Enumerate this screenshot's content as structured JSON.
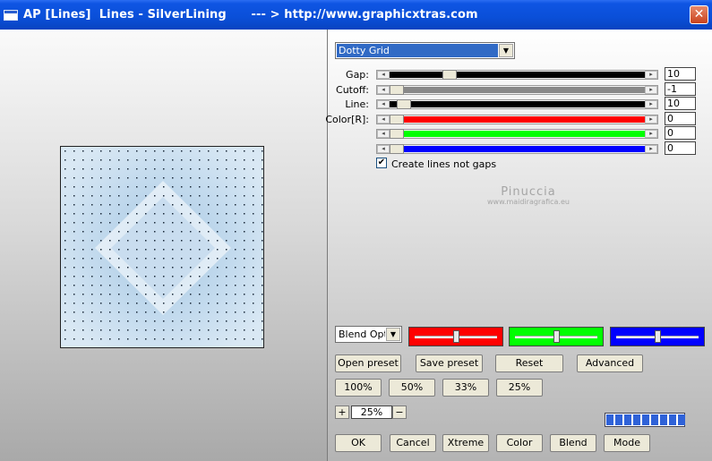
{
  "window": {
    "title": "AP [Lines]  Lines - SilverLining      --- > http://www.graphicxtras.com",
    "close": "✕"
  },
  "effect_dropdown": {
    "value": "Dotty Grid"
  },
  "sliders": [
    {
      "id": "gap",
      "label": "Gap:",
      "value": "10",
      "fill": "#000000",
      "thumb_fraction": 0.22
    },
    {
      "id": "cutoff",
      "label": "Cutoff:",
      "value": "-1",
      "fill": "#888888",
      "thumb_fraction": 0.0
    },
    {
      "id": "line",
      "label": "Line:",
      "value": "10",
      "fill": "#000000",
      "thumb_fraction": 0.03
    },
    {
      "id": "color-r",
      "label": "Color[R]:",
      "value": "0",
      "fill": "#ff0000",
      "thumb_fraction": 0.0
    },
    {
      "id": "color-g",
      "label": "",
      "value": "0",
      "fill": "#00ff00",
      "thumb_fraction": 0.0
    },
    {
      "id": "color-b",
      "label": "",
      "value": "0",
      "fill": "#0000ff",
      "thumb_fraction": 0.0
    }
  ],
  "checkbox": {
    "label": "Create lines not gaps",
    "checked": true,
    "mark": "✔"
  },
  "watermark": {
    "line1": "Pinuccia",
    "line2": "www.maidiragrafica.eu"
  },
  "blend_dropdown": {
    "value": "Blend Optic"
  },
  "color_sliders": [
    {
      "name": "red",
      "color": "#ff0000",
      "level": 0.5
    },
    {
      "name": "green",
      "color": "#00ff00",
      "level": 0.5
    },
    {
      "name": "blue",
      "color": "#0000ff",
      "level": 0.5
    }
  ],
  "preset_buttons": {
    "open": "Open preset",
    "save": "Save preset",
    "reset": "Reset",
    "advanced": "Advanced"
  },
  "zoom_buttons": [
    "100%",
    "50%",
    "33%",
    "25%"
  ],
  "zoom_stepper": {
    "plus": "+",
    "value": "25%",
    "minus": "−"
  },
  "progress": {
    "cells": 9
  },
  "bottom_buttons": {
    "ok": "OK",
    "cancel": "Cancel",
    "xtreme": "Xtreme",
    "color": "Color",
    "blend": "Blend",
    "mode": "Mode"
  },
  "icons": {
    "dropdown_arrow": "▼",
    "scroll_left": "◂",
    "scroll_right": "▸"
  }
}
